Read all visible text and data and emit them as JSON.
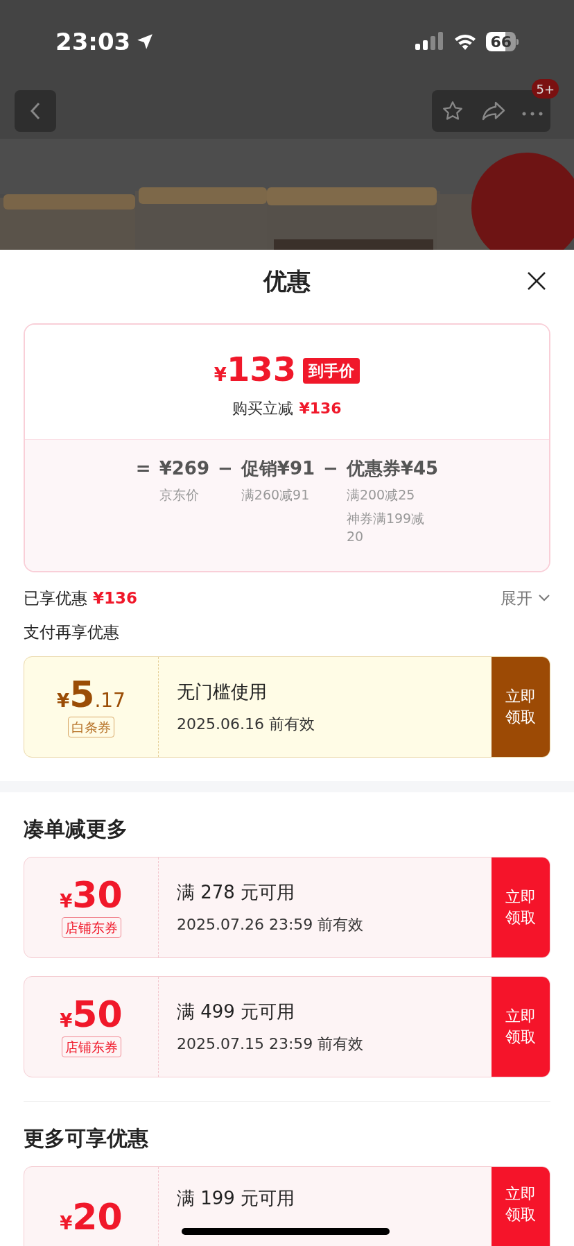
{
  "status_bar": {
    "time": "23:03",
    "battery": "66"
  },
  "nav": {
    "badge": "5+"
  },
  "sheet": {
    "title": "优惠",
    "price_card": {
      "currency": "¥",
      "price": "133",
      "price_tag": "到手价",
      "saving_label": "购买立减",
      "saving": "¥136",
      "breakdown": [
        {
          "operator": "=",
          "value": "¥269",
          "notes": [
            "京东价"
          ]
        },
        {
          "operator": "−",
          "value": "促销¥91",
          "notes": [
            "满260减91"
          ]
        },
        {
          "operator": "−",
          "value": "优惠券¥45",
          "notes": [
            "满200减25",
            "神券满199减20"
          ]
        }
      ]
    },
    "summary": {
      "label": "已享优惠",
      "amount": "¥136",
      "toggle": "展开"
    },
    "sections": [
      {
        "title": "支付再享优惠",
        "coupons": [
          {
            "kind": "baitiao",
            "currency": "¥",
            "amount": "5",
            "decimal": ".17",
            "tag": "白条券",
            "condition": "无门槛使用",
            "validity": "2025.06.16 前有效",
            "action": "立即领取"
          }
        ]
      },
      {
        "title": "凑单减更多",
        "coupons": [
          {
            "kind": "store",
            "currency": "¥",
            "amount": "30",
            "tag": "店铺东券",
            "condition": "满 278 元可用",
            "validity": "2025.07.26 23:59 前有效",
            "action": "立即领取"
          },
          {
            "kind": "store",
            "currency": "¥",
            "amount": "50",
            "tag": "店铺东券",
            "condition": "满 499 元可用",
            "validity": "2025.07.15 23:59 前有效",
            "action": "立即领取"
          }
        ]
      },
      {
        "title": "更多可享优惠",
        "coupons": [
          {
            "kind": "store",
            "currency": "¥",
            "amount": "20",
            "condition": "满 199 元可用",
            "action": "立即领取"
          }
        ]
      }
    ]
  }
}
